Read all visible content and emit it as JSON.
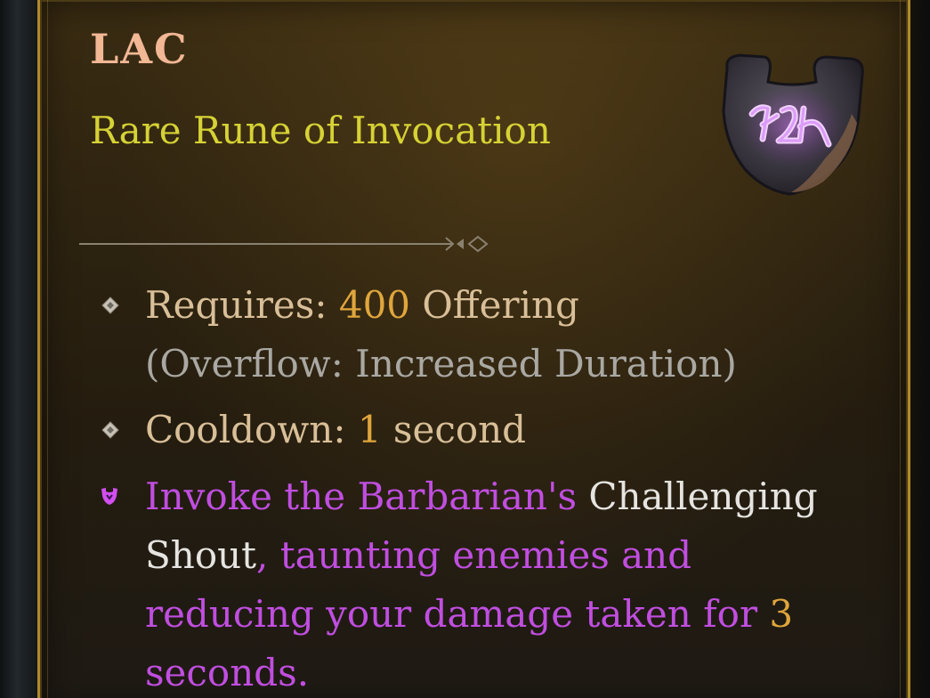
{
  "item": {
    "name": "LAC",
    "type": "Rare Rune of Invocation",
    "icon": "rune-shield-icon"
  },
  "colors": {
    "name": "#f2b795",
    "type": "#d6d235",
    "border": "#b08a2a",
    "label": "#d9bf98",
    "number": "#e0a63c",
    "note": "#a9a8a3",
    "highlight": "#e6e4e0",
    "effect": "#c04ee0"
  },
  "requires": {
    "label": "Requires: ",
    "value": "400",
    "unit": " Offering",
    "note": "(Overflow: Increased Duration)"
  },
  "cooldown": {
    "label": "Cooldown: ",
    "value": "1",
    "unit": " second"
  },
  "effect": {
    "part1": "Invoke the Barbarian's ",
    "skill": "Challenging Shout",
    "part2": ", taunting enemies and reducing your damage taken for ",
    "duration": "3",
    "part3": " seconds."
  }
}
